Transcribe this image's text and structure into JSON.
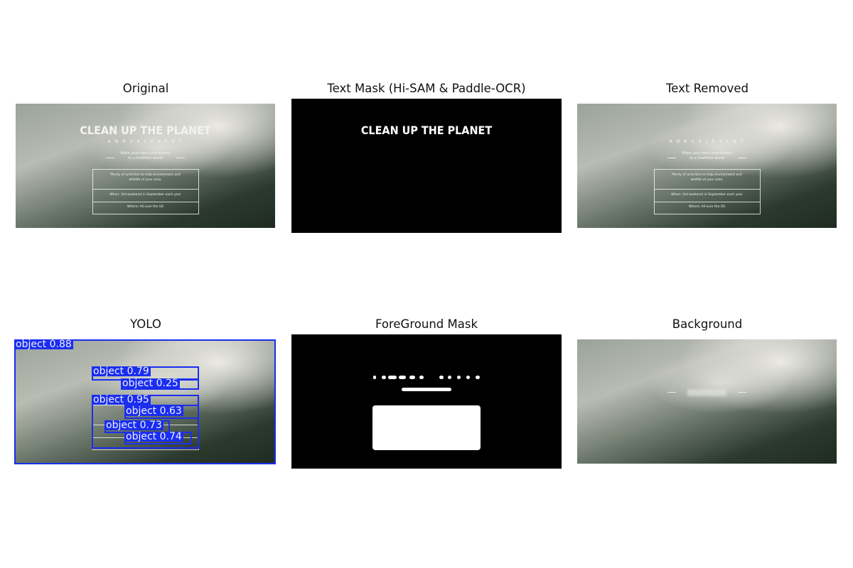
{
  "titles": {
    "original": "Original",
    "text_mask": "Text Mask (Hi-SAM & Paddle-OCR)",
    "text_removed": "Text Removed",
    "yolo": "YOLO",
    "foreground_mask": "ForeGround Mask",
    "background": "Background"
  },
  "poster": {
    "headline": "CLEAN UP THE PLANET",
    "subline": "A N N U A L     E V E N T",
    "tagline_1": "Make your own contribution",
    "tagline_2": "to a healthier world",
    "box1_line1": "Plenty of activities to help environment and",
    "box1_line2": "wildlife of your area.",
    "box2": "When: 3rd weekend in September each year",
    "box3": "Where: All over the US"
  },
  "detections": [
    {
      "label": "object 0.88"
    },
    {
      "label": "object 0.79"
    },
    {
      "label": "object 0.25"
    },
    {
      "label": "object 0.95"
    },
    {
      "label": "object 0.63"
    },
    {
      "label": "object 0.73"
    },
    {
      "label": "object 0.74"
    }
  ],
  "colors": {
    "detection": "#1a2ef0",
    "mask_bg": "#000000",
    "mask_fg": "#ffffff"
  }
}
